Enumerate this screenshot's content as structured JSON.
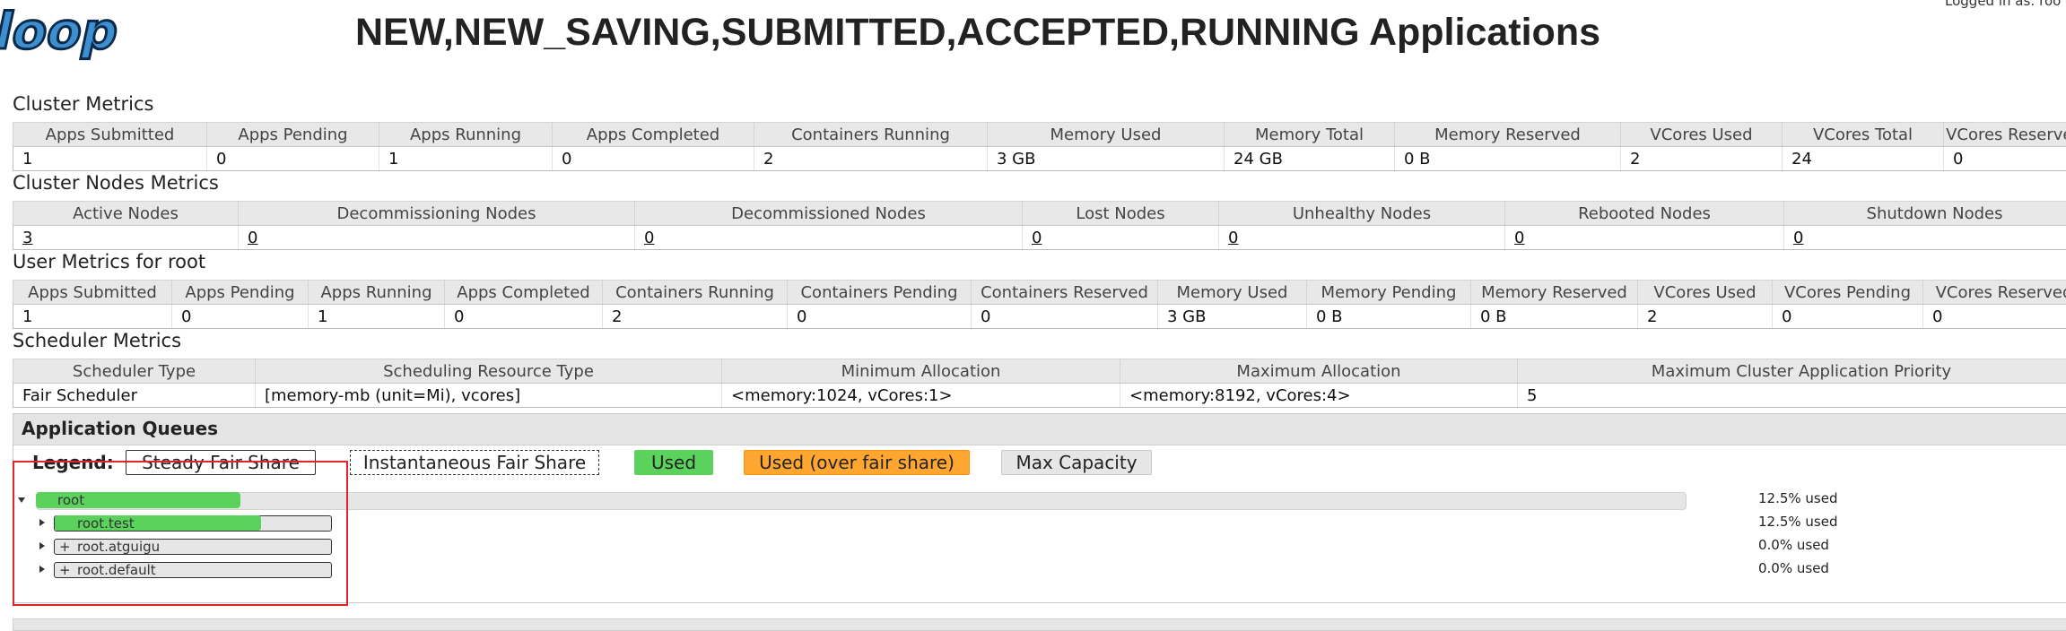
{
  "header": {
    "logo_text": "loop",
    "title": "NEW,NEW_SAVING,SUBMITTED,ACCEPTED,RUNNING Applications",
    "logged_in": "Logged in as: roo"
  },
  "cluster_metrics": {
    "title": "Cluster Metrics",
    "headers": [
      "Apps Submitted",
      "Apps Pending",
      "Apps Running",
      "Apps Completed",
      "Containers Running",
      "Memory Used",
      "Memory Total",
      "Memory Reserved",
      "VCores Used",
      "VCores Total",
      "VCores Reserved"
    ],
    "values": [
      "1",
      "0",
      "1",
      "0",
      "2",
      "3 GB",
      "24 GB",
      "0 B",
      "2",
      "24",
      "0"
    ]
  },
  "cluster_nodes_metrics": {
    "title": "Cluster Nodes Metrics",
    "headers": [
      "Active Nodes",
      "Decommissioning Nodes",
      "Decommissioned Nodes",
      "Lost Nodes",
      "Unhealthy Nodes",
      "Rebooted Nodes",
      "Shutdown Nodes"
    ],
    "values": [
      "3",
      "0",
      "0",
      "0",
      "0",
      "0",
      "0"
    ]
  },
  "user_metrics": {
    "title": "User Metrics for root",
    "headers": [
      "Apps Submitted",
      "Apps Pending",
      "Apps Running",
      "Apps Completed",
      "Containers Running",
      "Containers Pending",
      "Containers Reserved",
      "Memory Used",
      "Memory Pending",
      "Memory Reserved",
      "VCores Used",
      "VCores Pending",
      "VCores Reserved"
    ],
    "values": [
      "1",
      "0",
      "1",
      "0",
      "2",
      "0",
      "0",
      "3 GB",
      "0 B",
      "0 B",
      "2",
      "0",
      "0"
    ]
  },
  "scheduler_metrics": {
    "title": "Scheduler Metrics",
    "headers": [
      "Scheduler Type",
      "Scheduling Resource Type",
      "Minimum Allocation",
      "Maximum Allocation",
      "Maximum Cluster Application Priority"
    ],
    "values": [
      "Fair Scheduler",
      "[memory-mb (unit=Mi), vcores]",
      "<memory:1024, vCores:1>",
      "<memory:8192, vCores:4>",
      "5"
    ]
  },
  "application_queues": {
    "title": "Application Queues",
    "legend_label": "Legend:",
    "legend": {
      "steady": "Steady Fair Share",
      "instantaneous": "Instantaneous Fair Share",
      "used": "Used",
      "over": "Used (over fair share)",
      "max": "Max Capacity"
    },
    "colors": {
      "used": "#5bd25b",
      "over": "#ffa630",
      "max": "#e6e6e6",
      "highlight": "#e2232a"
    },
    "queues": [
      {
        "name": "root",
        "used": "12.5% used",
        "fill": 0.125
      },
      {
        "name": "root.test",
        "used": "12.5% used",
        "fill": 0.75
      },
      {
        "name": "root.atguigu",
        "used": "0.0% used",
        "fill": 0
      },
      {
        "name": "root.default",
        "used": "0.0% used",
        "fill": 0
      }
    ]
  }
}
